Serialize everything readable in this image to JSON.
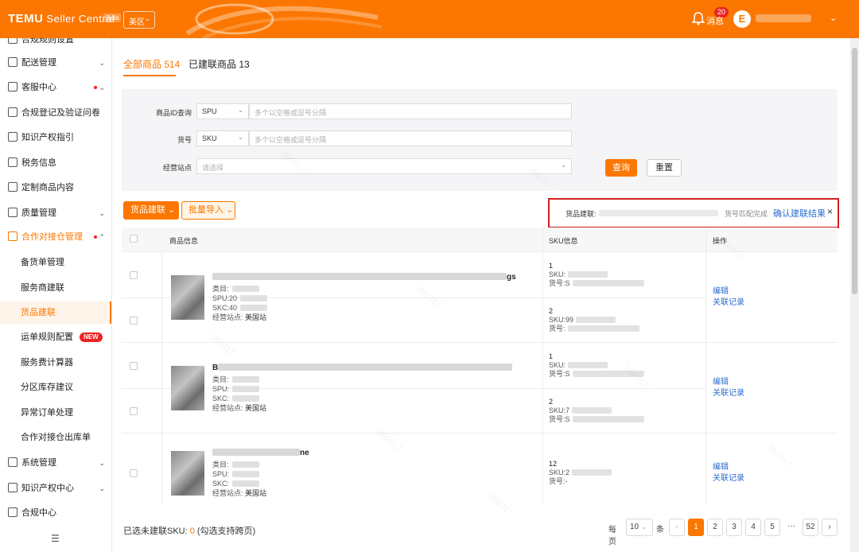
{
  "header": {
    "logo": "TEMU",
    "product": "Seller Central",
    "beta": "Beta",
    "region": "美区",
    "messages_label": "消息",
    "messages_count": "20",
    "avatar_letter": "E"
  },
  "sidebar": {
    "items": [
      {
        "label": "合规规则设置",
        "icon": "doc-icon"
      },
      {
        "label": "配送管理",
        "icon": "truck-icon",
        "chevron": true
      },
      {
        "label": "客服中心",
        "icon": "chat-icon",
        "chevron": true,
        "dot": true
      },
      {
        "label": "合规登记及验证问卷",
        "icon": "check-doc-icon"
      },
      {
        "label": "知识产权指引",
        "icon": "book-icon"
      },
      {
        "label": "税务信息",
        "icon": "tax-icon"
      },
      {
        "label": "定制商品内容",
        "icon": "customize-icon"
      },
      {
        "label": "质量管理",
        "icon": "shield-check-icon",
        "chevron": true
      },
      {
        "label": "合作对接仓管理",
        "icon": "warehouse-icon",
        "chevron": true,
        "dot": true,
        "active": true
      },
      {
        "label": "备货单管理"
      },
      {
        "label": "服务商建联"
      },
      {
        "label": "货品建联",
        "current": true
      },
      {
        "label": "运单规则配置",
        "badge": "NEW"
      },
      {
        "label": "服务费计算器"
      },
      {
        "label": "分区库存建议"
      },
      {
        "label": "异常订单处理"
      },
      {
        "label": "合作对接仓出库单"
      },
      {
        "label": "系统管理",
        "icon": "system-icon",
        "chevron": true
      },
      {
        "label": "知识产权中心",
        "icon": "copyright-icon",
        "chevron": true
      },
      {
        "label": "合规中心",
        "icon": "compliance-icon"
      }
    ]
  },
  "tabs": {
    "all": "全部商品 514",
    "linked": "已建联商品 13"
  },
  "filters": {
    "id_label": "商品ID查询",
    "id_type": "SPU",
    "id_placeholder": "多个以空格或逗号分隔",
    "sku_label": "货号",
    "sku_type": "SKU",
    "sku_placeholder": "多个以空格或逗号分隔",
    "site_label": "经营站点",
    "site_placeholder": "请选择",
    "query": "查询",
    "reset": "重置"
  },
  "actions": {
    "link": "货品建联",
    "batch_import": "批量导入"
  },
  "notice": {
    "label": "货品建联:",
    "status": "货号匹配完成",
    "confirm": "确认建联结果",
    "close": "×"
  },
  "table": {
    "headers": {
      "product": "商品信息",
      "sku": "SKU信息",
      "ops": "操作"
    },
    "meta_labels": {
      "category": "类目:",
      "spu": "SPU:",
      "skc": "SKC:",
      "site": "经营站点:"
    },
    "sku_labels": {
      "sku": "SKU:",
      "code": "货号:"
    },
    "rows": [
      {
        "title_tail": "gs",
        "meta_visible": {
          "category": "",
          "spu": "20",
          "skc": "40",
          "site": "美国站"
        },
        "skus": [
          {
            "num": "1",
            "sku": "",
            "code": "S"
          },
          {
            "num": "2",
            "sku": "99",
            "code": ""
          }
        ],
        "ops": [
          "编辑",
          "关联记录"
        ]
      },
      {
        "title_head": "B",
        "meta_visible": {
          "category": "",
          "spu": "",
          "skc": "",
          "site": "美国站"
        },
        "skus": [
          {
            "num": "1",
            "sku": "",
            "code": "S"
          },
          {
            "num": "2",
            "sku": "7",
            "code": "S"
          }
        ],
        "ops": [
          "编辑",
          "关联记录"
        ]
      },
      {
        "title_tail": "ne",
        "meta_visible": {
          "category": "",
          "spu": "",
          "skc": "",
          "site": "美国站"
        },
        "skus": [
          {
            "num": "12",
            "sku": "2",
            "code": "-"
          }
        ],
        "ops": [
          "编辑",
          "关联记录"
        ]
      }
    ]
  },
  "footer": {
    "selected_label": "已选未建联SKU:",
    "selected_count": "0",
    "selected_hint": "(勾选支持跨页)",
    "per_page_label": "每页",
    "per_page": "10",
    "per_page_unit": "条",
    "pages": [
      "1",
      "2",
      "3",
      "4",
      "5",
      "···",
      "52"
    ],
    "current_page": "1",
    "prev": "‹",
    "next": "›"
  },
  "colors": {
    "brand": "#fb7701",
    "link": "#2d6fd0",
    "notice_border": "#d42020"
  }
}
